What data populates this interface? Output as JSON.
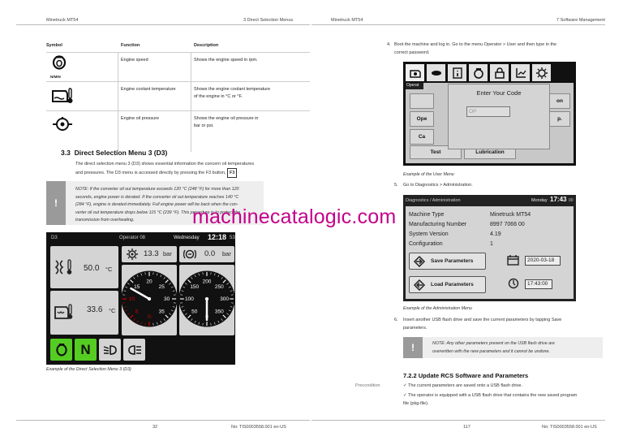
{
  "left_page": {
    "header_left": "Minetruck MT54",
    "header_right": "3 Direct Selection Menus",
    "footer_page": "32",
    "footer_doc": "No: TIS0003558.001 en-US",
    "table": {
      "headers": [
        "Symbol",
        "Function",
        "Description"
      ],
      "rows": [
        {
          "symbol_icon": "engine-speed-icon",
          "symbol_text": "N/MIN",
          "function": "Engine speed",
          "description": "Shows the engine speed in rpm."
        },
        {
          "symbol_icon": "coolant-temperature-icon",
          "symbol_text": "",
          "function": "Engine coolant temperature",
          "description_lines": [
            "Shows the engine coolant temperature",
            "of the engine in °C or °F."
          ]
        },
        {
          "symbol_icon": "oil-pressure-icon",
          "symbol_text": "",
          "function": "Engine oil pressure",
          "description_lines": [
            "Shows the engine oil pressure in",
            "bar or psi."
          ]
        }
      ]
    },
    "section": {
      "number": "3.3",
      "title": "Direct Selection Menu 3 (D3)",
      "para_lines": [
        "The direct selection menu 3 (D3) shows essential information the concern oil temperatures",
        "and pressures. The D3 menu is accessed directly by pressing the F3 button,"
      ],
      "key": "F3"
    },
    "note": {
      "icon": "!",
      "lines": [
        "NOTE: If the converter oil out temperature exceeds 120 °C (248 °F) for more than 120",
        "seconds, engine power is derated. If the converter oil out temperature reaches 140 °C",
        "(284 °F), engine is derated immediately. Full engine power will be back when the con-",
        "verter oil out temperature drops below 115 °C (239 °F). This procedure is to protect the",
        "transmission from overheating."
      ]
    },
    "d3_screen": {
      "menu": "D3",
      "operator": "Operator 08",
      "day": "Wednesday",
      "time": "12:18",
      "seconds": "53",
      "temp1": "50.0",
      "temp2": "33.6",
      "temp_unit": "°C",
      "pressure1": "13.3",
      "pressure2": "0.0",
      "pressure_unit": "bar",
      "gauge1_ticks": [
        "0",
        "5",
        "10",
        "15",
        "20",
        "25",
        "30",
        "35"
      ],
      "gauge2_ticks": [
        "0",
        "50",
        "100",
        "150",
        "200",
        "250",
        "300",
        "350"
      ],
      "gauge1_value": 13.3,
      "gauge2_value": 0.0,
      "bottom_letter": "N"
    },
    "caption": "Example of the Direct Selection Menu 3 (D3)"
  },
  "right_page": {
    "header_left": "Minetruck MT54",
    "header_right": "7 Software Management",
    "footer_page": "117",
    "footer_doc": "No: TIS0003558.001 en-US",
    "step4": {
      "number": "4.",
      "lines": [
        "Boot the machine and log in. Go to the menu Operator > User and then type in the",
        "correct password."
      ]
    },
    "user_menu": {
      "tab_label": "Operat",
      "dialog_title": "Enter Your Code",
      "code_value": "OP",
      "buttons": [
        "Ope",
        "Ca",
        "on",
        "p.",
        "Test",
        "Lubrication"
      ]
    },
    "caption_user": "Example of the User Menu",
    "step5": {
      "number": "5.",
      "text": "Go to Diagnostics > Administration."
    },
    "admin_menu": {
      "breadcrumb": "Diagnostics / Administration",
      "day": "Monday",
      "time": "17:43",
      "seconds": "00",
      "labels": [
        "Machine Type",
        "Manufacturing Number",
        "System Version",
        "Configuration"
      ],
      "values": [
        "Minetruck MT54",
        "8997 7066 00",
        "4.19",
        "1"
      ],
      "save_label": "Save Parameters",
      "load_label": "Load Parameters",
      "date": "2020-03-18",
      "time_field": "17:43:00"
    },
    "caption_admin": "Example of the Administration Menu",
    "step6": {
      "number": "6.",
      "lines": [
        "Insert another USB flash drive and save the current parameters by tapping Save",
        "parameters."
      ]
    },
    "note": {
      "icon": "!",
      "lines": [
        "NOTE: Any other parameters present on the USB flash drive are",
        "overwritten with the new parameters and it cannot be undone."
      ]
    },
    "subsection": "7.2.2 Update RCS Software and Parameters",
    "precondition_label": "Precondition",
    "preconditions": [
      "The current parameters are saved onto a USB flash drive.",
      "The operator is equipped with a USB flash drive that contains the new saved program",
      "file (pkg-file)."
    ]
  },
  "watermark": "machinecatalogic.com",
  "colors": {
    "accent_green": "#55cc22",
    "watermark": "#c4008a",
    "gauge_red": "#dd0000"
  }
}
